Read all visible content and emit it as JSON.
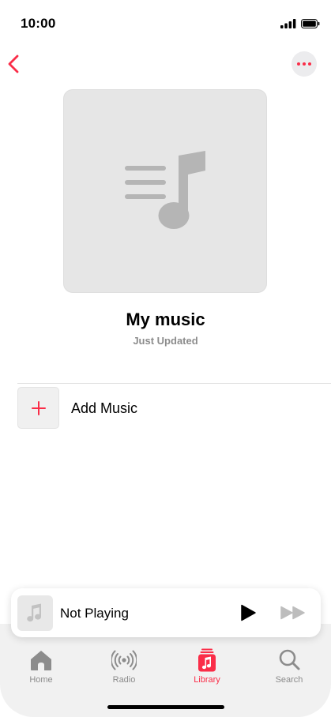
{
  "status_bar": {
    "time": "10:00"
  },
  "playlist": {
    "title": "My music",
    "subtitle": "Just Updated"
  },
  "actions": {
    "add_music_label": "Add Music"
  },
  "mini_player": {
    "title": "Not Playing"
  },
  "tabs": [
    {
      "label": "Home",
      "icon": "house-icon",
      "active": false
    },
    {
      "label": "Radio",
      "icon": "radio-waves-icon",
      "active": false
    },
    {
      "label": "Library",
      "icon": "music-library-icon",
      "active": true
    },
    {
      "label": "Search",
      "icon": "magnifier-icon",
      "active": false
    }
  ],
  "colors": {
    "accent": "#fa2d48",
    "inactive": "#8c8c8c",
    "tile": "#e6e6e6"
  }
}
